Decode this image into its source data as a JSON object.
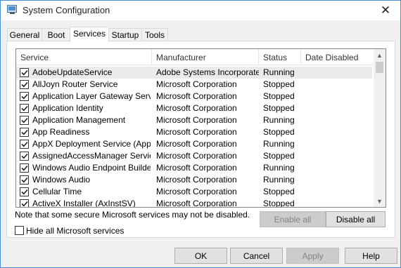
{
  "window": {
    "title": "System Configuration",
    "close": "✕"
  },
  "tabs": [
    {
      "label": "General"
    },
    {
      "label": "Boot"
    },
    {
      "label": "Services"
    },
    {
      "label": "Startup"
    },
    {
      "label": "Tools"
    }
  ],
  "columns": {
    "service": "Service",
    "manufacturer": "Manufacturer",
    "status": "Status",
    "date_disabled": "Date Disabled"
  },
  "services": [
    {
      "name": "AdobeUpdateService",
      "manufacturer": "Adobe Systems Incorporated",
      "status": "Running",
      "date_disabled": "",
      "checked": true
    },
    {
      "name": "AllJoyn Router Service",
      "manufacturer": "Microsoft Corporation",
      "status": "Stopped",
      "date_disabled": "",
      "checked": true
    },
    {
      "name": "Application Layer Gateway Service",
      "manufacturer": "Microsoft Corporation",
      "status": "Stopped",
      "date_disabled": "",
      "checked": true
    },
    {
      "name": "Application Identity",
      "manufacturer": "Microsoft Corporation",
      "status": "Stopped",
      "date_disabled": "",
      "checked": true
    },
    {
      "name": "Application Management",
      "manufacturer": "Microsoft Corporation",
      "status": "Running",
      "date_disabled": "",
      "checked": true
    },
    {
      "name": "App Readiness",
      "manufacturer": "Microsoft Corporation",
      "status": "Stopped",
      "date_disabled": "",
      "checked": true
    },
    {
      "name": "AppX Deployment Service (AppX...",
      "manufacturer": "Microsoft Corporation",
      "status": "Running",
      "date_disabled": "",
      "checked": true
    },
    {
      "name": "AssignedAccessManager Service",
      "manufacturer": "Microsoft Corporation",
      "status": "Stopped",
      "date_disabled": "",
      "checked": true
    },
    {
      "name": "Windows Audio Endpoint Builder",
      "manufacturer": "Microsoft Corporation",
      "status": "Running",
      "date_disabled": "",
      "checked": true
    },
    {
      "name": "Windows Audio",
      "manufacturer": "Microsoft Corporation",
      "status": "Running",
      "date_disabled": "",
      "checked": true
    },
    {
      "name": "Cellular Time",
      "manufacturer": "Microsoft Corporation",
      "status": "Stopped",
      "date_disabled": "",
      "checked": true
    },
    {
      "name": "ActiveX Installer (AxInstSV)",
      "manufacturer": "Microsoft Corporation",
      "status": "Stopped",
      "date_disabled": "",
      "checked": true
    }
  ],
  "note": "Note that some secure Microsoft services may not be disabled.",
  "buttons": {
    "enable_all": "Enable all",
    "disable_all": "Disable all",
    "ok": "OK",
    "cancel": "Cancel",
    "apply": "Apply",
    "help": "Help"
  },
  "hide_ms": {
    "label": "Hide all Microsoft services",
    "checked": false
  },
  "scroll_icons": {
    "up": "chevron-up-icon",
    "down": "chevron-down-icon"
  }
}
